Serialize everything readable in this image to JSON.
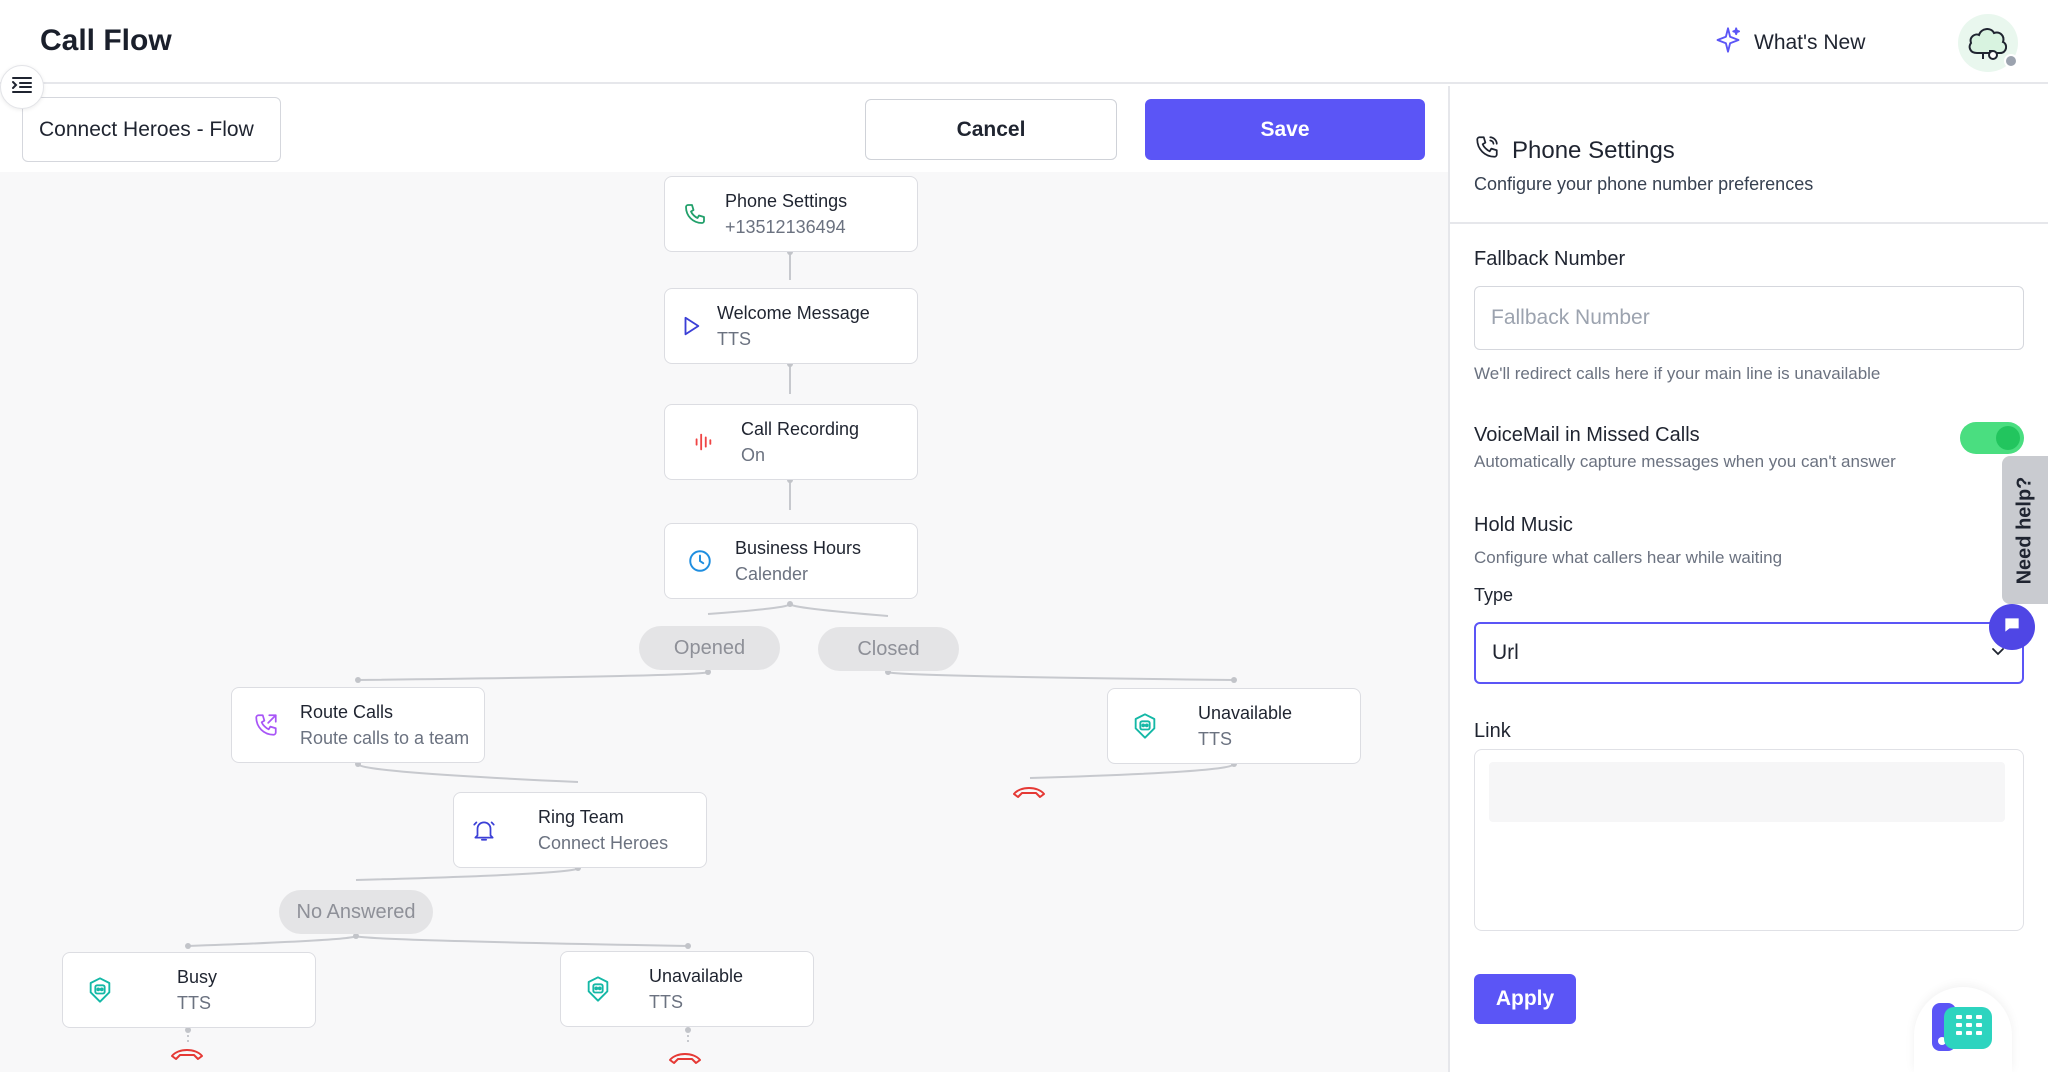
{
  "header": {
    "title": "Call Flow",
    "whats_new": "What's New"
  },
  "toolbar": {
    "flow_name": "Connect Heroes - Flow",
    "cancel_label": "Cancel",
    "save_label": "Save"
  },
  "flow": {
    "nodes": {
      "phone_settings": {
        "title": "Phone Settings",
        "sub": "+13512136494",
        "icon": "phone-icon"
      },
      "welcome_message": {
        "title": "Welcome Message",
        "sub": "TTS",
        "icon": "play-icon"
      },
      "call_recording": {
        "title": "Call Recording",
        "sub": "On",
        "icon": "waveform-icon"
      },
      "business_hours": {
        "title": "Business Hours",
        "sub": "Calender",
        "icon": "clock-icon"
      },
      "route_calls": {
        "title": "Route Calls",
        "sub": "Route calls to a team",
        "icon": "phone-forward-icon"
      },
      "unavailable_closed": {
        "title": "Unavailable",
        "sub": "TTS",
        "icon": "robot-icon"
      },
      "ring_team": {
        "title": "Ring Team",
        "sub": "Connect Heroes",
        "icon": "bell-icon"
      },
      "busy": {
        "title": "Busy",
        "sub": "TTS",
        "icon": "robot-icon"
      },
      "unavailable_no_answer": {
        "title": "Unavailable",
        "sub": "TTS",
        "icon": "robot-icon"
      }
    },
    "branches": {
      "opened": "Opened",
      "closed": "Closed",
      "no_answered": "No Answered"
    }
  },
  "panel": {
    "title": "Phone Settings",
    "subtitle": "Configure your phone number preferences",
    "fallback_label": "Fallback Number",
    "fallback_placeholder": "Fallback Number",
    "fallback_value": "",
    "fallback_hint": "We'll redirect calls here if your main line is unavailable",
    "voicemail_label": "VoiceMail in Missed Calls",
    "voicemail_hint": "Automatically capture messages when you can't answer",
    "voicemail_enabled": true,
    "hold_music_label": "Hold Music",
    "hold_music_hint": "Configure what callers hear while waiting",
    "type_label": "Type",
    "type_value": "Url",
    "link_label": "Link",
    "link_value": "",
    "apply_label": "Apply"
  },
  "help": {
    "need_help": "Need help?"
  },
  "colors": {
    "accent": "#5b55f6",
    "toggle_on": "#4ade80",
    "hangup": "#e53935"
  }
}
